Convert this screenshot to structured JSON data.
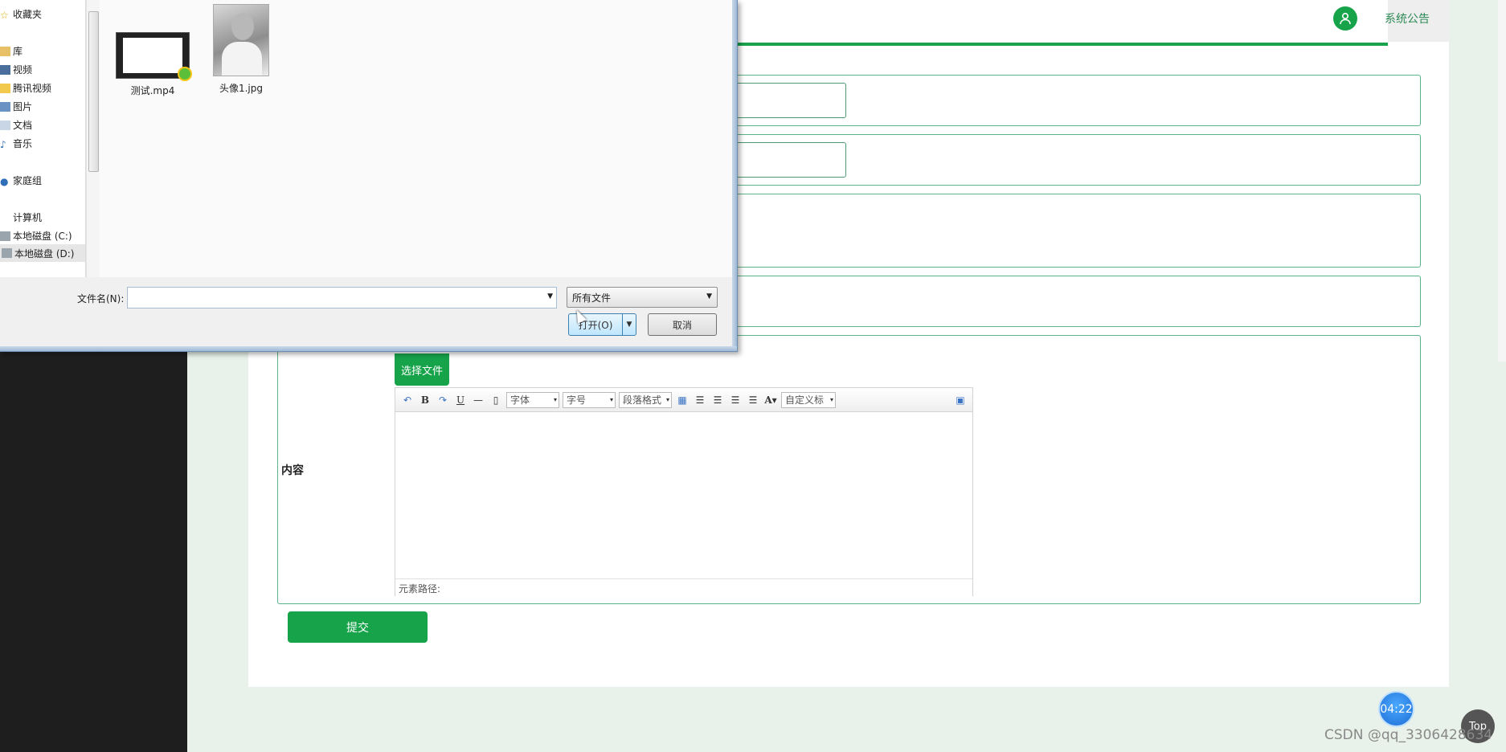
{
  "header": {
    "tab_label": "系统公告",
    "avatar_icon": "user-icon"
  },
  "form": {
    "content_label": "内容",
    "choose_file_label": "选择文件",
    "submit_label": "提交"
  },
  "editor": {
    "toolbar": {
      "icons": [
        "undo-icon",
        "bold-icon",
        "redo-icon",
        "underline-icon",
        "horizontal-rule-icon",
        "page-icon",
        "table-icon",
        "align-left-icon",
        "align-right-icon",
        "align-center-icon",
        "align-justify-icon",
        "font-color-icon",
        "fullscreen-icon"
      ],
      "font_family": "字体",
      "font_size": "字号",
      "paragraph": "段落格式",
      "custom_title": "自定义标"
    },
    "element_path": "元素路径:"
  },
  "file_dialog": {
    "nav": {
      "favorites": "收藏夹",
      "libraries": "库",
      "videos": "视频",
      "tencent_video": "腾讯视频",
      "pictures": "图片",
      "documents": "文档",
      "music": "音乐",
      "homegroup": "家庭组",
      "computer": "计算机",
      "disk_c": "本地磁盘 (C:)",
      "disk_d": "本地磁盘 (D:)"
    },
    "files": [
      {
        "name": "测试.mp4",
        "icon": "video-file-icon"
      },
      {
        "name": "头像1.jpg",
        "icon": "image-file-icon"
      }
    ],
    "filename_label": "文件名(N):",
    "filename_value": "",
    "filetype_value": "所有文件",
    "open_label": "打开(O)",
    "cancel_label": "取消"
  },
  "widgets": {
    "timer": "04:22",
    "top_label": "Top"
  },
  "watermark": "CSDN @qq_3306428634",
  "colors": {
    "accent": "#17a34a",
    "border": "#5bb38a",
    "sidebar": "#1e1e1e",
    "page_bg": "#e8f2ea"
  }
}
